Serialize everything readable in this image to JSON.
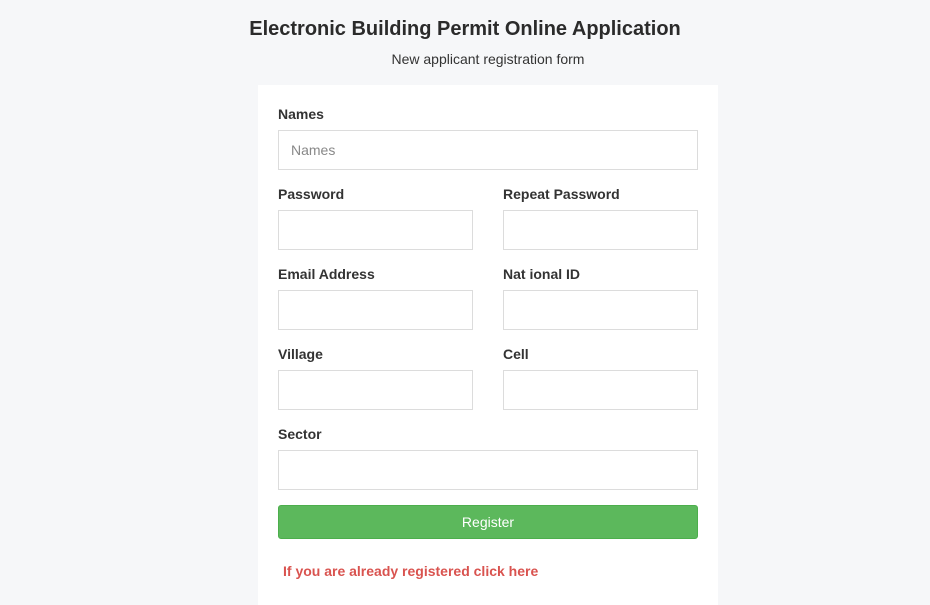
{
  "header": {
    "title": "Electronic Building Permit Online Application",
    "subtitle": "New applicant registration form"
  },
  "form": {
    "names": {
      "label": "Names",
      "placeholder": "Names",
      "value": ""
    },
    "password": {
      "label": "Password",
      "value": ""
    },
    "repeat_password": {
      "label": "Repeat Password",
      "value": ""
    },
    "email": {
      "label": "Email Address",
      "value": ""
    },
    "national_id": {
      "label": "Nat ional ID",
      "value": ""
    },
    "village": {
      "label": "Village",
      "value": ""
    },
    "cell": {
      "label": "Cell",
      "value": ""
    },
    "sector": {
      "label": "Sector",
      "value": ""
    },
    "register_label": "Register",
    "login_link": "If you are already registered click here"
  },
  "colors": {
    "background": "#f6f7f9",
    "card": "#ffffff",
    "button": "#5cb85c",
    "link": "#d9534f"
  }
}
